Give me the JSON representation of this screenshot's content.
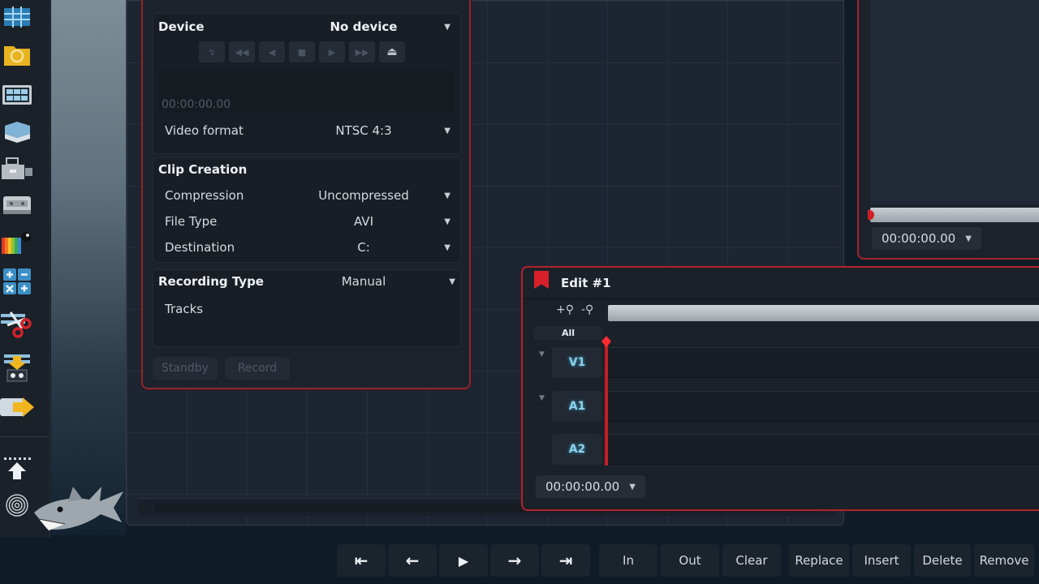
{
  "toolbar": {
    "icons": [
      {
        "name": "storyboard-icon",
        "label": "Storyboard"
      },
      {
        "name": "media-folder-icon",
        "label": "Media folder"
      },
      {
        "name": "grid-view-icon",
        "label": "Grid view"
      },
      {
        "name": "layers-icon",
        "label": "Layers"
      },
      {
        "name": "capture-device-icon",
        "label": "Capture device"
      },
      {
        "name": "tape-deck-icon",
        "label": "Tape deck"
      },
      {
        "name": "color-bars-icon",
        "label": "Color bars"
      },
      {
        "name": "calculator-icon",
        "label": "Calculator"
      },
      {
        "name": "cut-icon",
        "label": "Cut"
      },
      {
        "name": "import-icon",
        "label": "Import"
      },
      {
        "name": "export-icon",
        "label": "Export"
      },
      {
        "name": "upload-icon",
        "label": "Upload"
      },
      {
        "name": "fingerprint-icon",
        "label": "Fingerprint"
      }
    ],
    "mascot": "shark-mascot"
  },
  "capture_panel": {
    "device_label": "Device",
    "device_value": "No device",
    "transport_buttons": [
      "connect-icon",
      "rewind-icon",
      "step-back-icon",
      "stop-icon",
      "play-icon",
      "fast-forward-icon",
      "eject-icon"
    ],
    "timecode": "00:00:00.00",
    "video_format_label": "Video format",
    "video_format_value": "NTSC 4:3",
    "clip_creation_header": "Clip Creation",
    "compression_label": "Compression",
    "compression_value": "Uncompressed",
    "file_type_label": "File Type",
    "file_type_value": "AVI",
    "destination_label": "Destination",
    "destination_value": "C:",
    "recording_type_label": "Recording Type",
    "recording_type_value": "Manual",
    "tracks_label": "Tracks",
    "standby_label": "Standby",
    "record_label": "Record",
    "caret": "▼"
  },
  "player_panel": {
    "timecode": "00:00:00.00",
    "caret": "▼"
  },
  "edit_panel": {
    "title": "Edit #1",
    "zoom_in": "+⚲",
    "zoom_out": "-⚲",
    "all_label": "All",
    "tracks": [
      {
        "label": "V1",
        "expandable": true
      },
      {
        "label": "A1",
        "expandable": true
      },
      {
        "label": "A2",
        "expandable": false
      }
    ],
    "timecode": "00:00:00.00",
    "caret": "▼",
    "expand_glyph": "▼"
  },
  "transport": {
    "go_start": "⇤",
    "step_back": "←",
    "play": "▶",
    "step_forward": "→",
    "go_end": "⇥",
    "in_label": "In",
    "out_label": "Out",
    "clear_label": "Clear",
    "replace_label": "Replace",
    "insert_label": "Insert",
    "delete_label": "Delete",
    "remove_label": "Remove"
  }
}
